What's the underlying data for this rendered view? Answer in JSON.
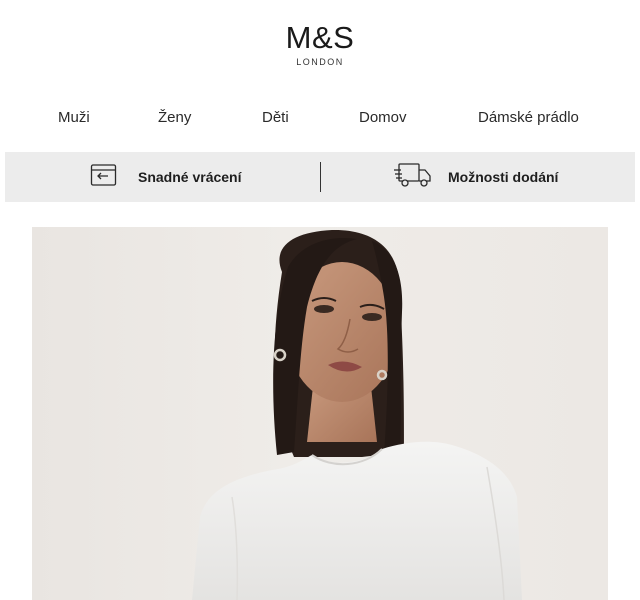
{
  "brand": {
    "name": "M&S",
    "tagline": "LONDON"
  },
  "nav": {
    "items": [
      {
        "label": "Muži"
      },
      {
        "label": "Ženy"
      },
      {
        "label": "Děti"
      },
      {
        "label": "Domov"
      },
      {
        "label": "Dámské prádlo"
      }
    ]
  },
  "services": {
    "returns_label": "Snadné vrácení",
    "returns_icon": "return-card-icon",
    "delivery_label": "Možnosti dodání",
    "delivery_icon": "delivery-truck-icon"
  },
  "hero": {
    "image": "woman-in-white-top-photo"
  },
  "colors": {
    "service_bar": "#ececec",
    "hero_bg": "#ece8e4",
    "text": "#222222"
  }
}
